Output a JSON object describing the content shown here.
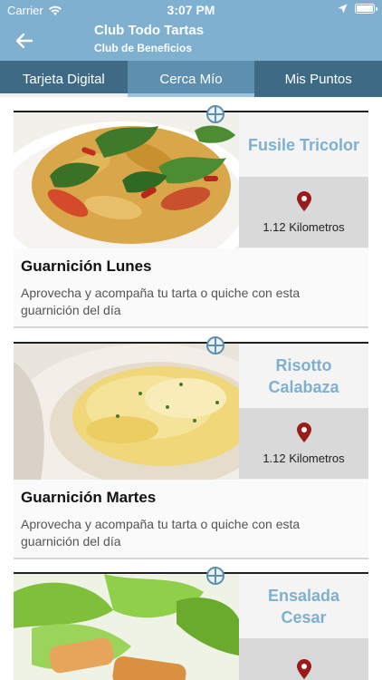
{
  "status_bar": {
    "carrier": "Carrier",
    "time": "3:07 PM"
  },
  "nav": {
    "title": "Club Todo Tartas",
    "subtitle": "Club de Beneficios"
  },
  "tabs": [
    {
      "label": "Tarjeta Digital",
      "active": false
    },
    {
      "label": "Cerca Mío",
      "active": true
    },
    {
      "label": "Mis Puntos",
      "active": false
    }
  ],
  "items": [
    {
      "place": "Fusile Tricolor",
      "distance": "1.12 Kilometros",
      "name": "Guarnición Lunes",
      "description": "Aprovecha y acompaña tu tarta o quiche con esta guarnición del día",
      "image": "pasta-salad-image"
    },
    {
      "place": "Risotto Calabaza",
      "distance": "1.12 Kilometros",
      "name": "Guarnición Martes",
      "description": "Aprovecha y acompaña tu tarta o quiche con esta guarnición del día",
      "image": "risotto-image"
    },
    {
      "place": "Ensalada Cesar",
      "distance": "",
      "name": "",
      "description": "",
      "image": "caesar-salad-image"
    }
  ],
  "colors": {
    "header": "#7fb0cf",
    "tabs": "#3e6a85",
    "accent": "#5e8fae",
    "pin": "#9b1b1b"
  }
}
